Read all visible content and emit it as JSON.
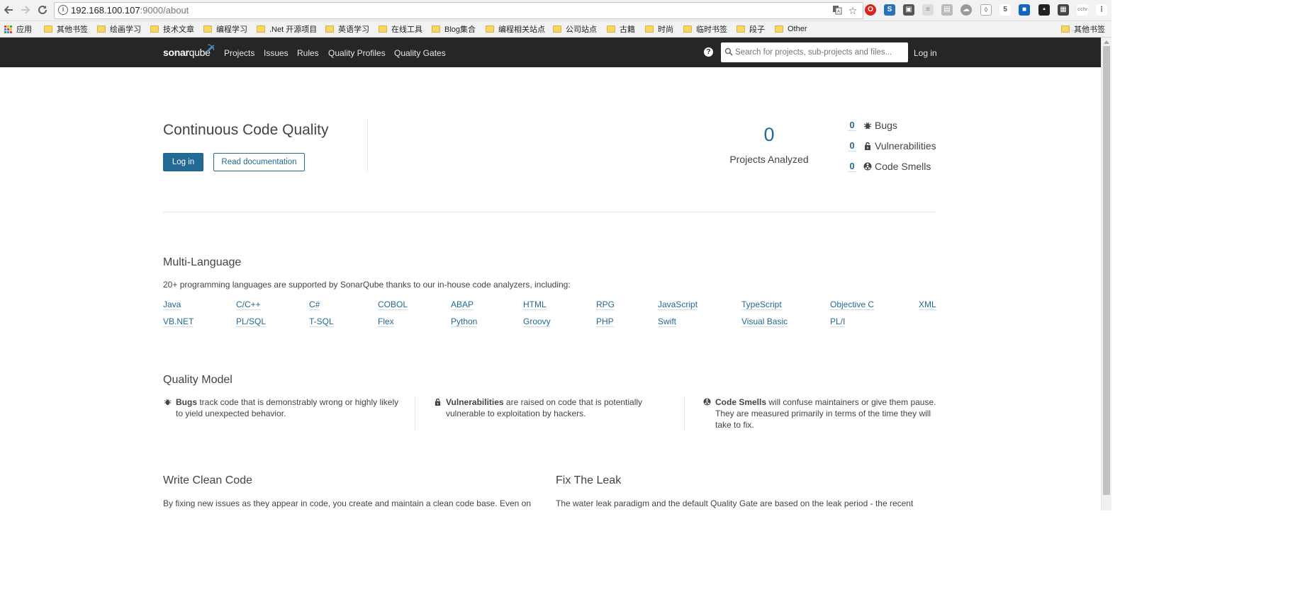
{
  "browser": {
    "url_host": "192.168.100.107",
    "url_path": ":9000/about",
    "bookmarks": [
      {
        "label": "应用",
        "type": "apps"
      },
      {
        "label": "其他书签",
        "type": "folder"
      },
      {
        "label": "绘画学习",
        "type": "folder"
      },
      {
        "label": "技术文章",
        "type": "folder"
      },
      {
        "label": "编程学习",
        "type": "folder"
      },
      {
        "label": ".Net 开源项目",
        "type": "folder"
      },
      {
        "label": "英语学习",
        "type": "folder"
      },
      {
        "label": "在线工具",
        "type": "folder"
      },
      {
        "label": "Blog集合",
        "type": "folder"
      },
      {
        "label": "编程相关站点",
        "type": "folder"
      },
      {
        "label": "公司站点",
        "type": "folder"
      },
      {
        "label": "古籍",
        "type": "folder"
      },
      {
        "label": "时尚",
        "type": "folder"
      },
      {
        "label": "临时书签",
        "type": "folder"
      },
      {
        "label": "段子",
        "type": "folder"
      },
      {
        "label": "Other",
        "type": "folder"
      },
      {
        "label": "其他书签",
        "type": "folder"
      }
    ]
  },
  "nav": {
    "logo_bold": "sonar",
    "logo_light": "qube",
    "links": [
      "Projects",
      "Issues",
      "Rules",
      "Quality Profiles",
      "Quality Gates"
    ],
    "help": "?",
    "search_placeholder": "Search for projects, sub-projects and files...",
    "login": "Log in"
  },
  "hero": {
    "title": "Continuous Code Quality",
    "login_button": "Log in",
    "docs_button": "Read documentation",
    "projects_count": "0",
    "projects_label": "Projects Analyzed",
    "stats": [
      {
        "count": "0",
        "label": "Bugs",
        "icon": "bug-icon"
      },
      {
        "count": "0",
        "label": "Vulnerabilities",
        "icon": "lock-icon"
      },
      {
        "count": "0",
        "label": "Code Smells",
        "icon": "code-smell-icon"
      }
    ]
  },
  "languages": {
    "heading": "Multi-Language",
    "description": "20+ programming languages are supported by SonarQube thanks to our in-house code analyzers, including:",
    "row1": [
      "Java",
      "C/C++",
      "C#",
      "COBOL",
      "ABAP",
      "HTML",
      "RPG",
      "JavaScript",
      "TypeScript",
      "Objective C",
      "XML"
    ],
    "row2": [
      "VB.NET",
      "PL/SQL",
      "T-SQL",
      "Flex",
      "Python",
      "Groovy",
      "PHP",
      "Swift",
      "Visual Basic",
      "PL/I"
    ]
  },
  "quality_model": {
    "heading": "Quality Model",
    "items": [
      {
        "title": "Bugs",
        "text": " track code that is demonstrably wrong or highly likely to yield unexpected behavior.",
        "icon": "bug-icon"
      },
      {
        "title": "Vulnerabilities",
        "text": " are raised on code that is potentially vulnerable to exploitation by hackers.",
        "icon": "lock-icon"
      },
      {
        "title": "Code Smells",
        "text": " will confuse maintainers or give them pause. They are measured primarily in terms of the time they will take to fix.",
        "icon": "code-smell-icon"
      }
    ]
  },
  "clean_code": {
    "heading": "Write Clean Code",
    "text": "By fixing new issues as they appear in code, you create and maintain a clean code base. Even on"
  },
  "leak": {
    "heading": "Fix The Leak",
    "text": "The water leak paradigm and the default Quality Gate are based on the leak period - the recent"
  },
  "colors": {
    "accent": "#236a97",
    "topbar": "#262626",
    "text": "#444444"
  }
}
